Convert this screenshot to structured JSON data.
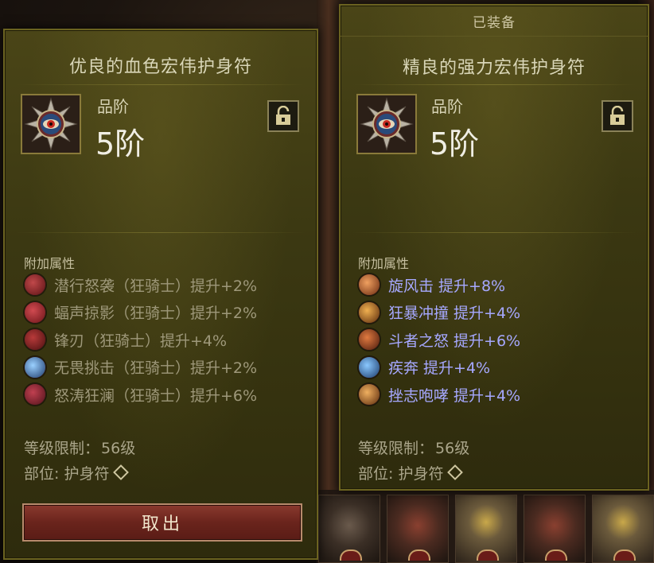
{
  "left_item": {
    "title": "优良的血色宏伟护身符",
    "tier_label": "品阶",
    "tier_value": "5阶",
    "section_label": "附加属性",
    "affixes": [
      {
        "text": "潜行怒袭（狂骑士）提升+2%",
        "icon": "stealth-strike-icon",
        "color": "#7a1e22"
      },
      {
        "text": "蝠声掠影（狂骑士）提升+2%",
        "icon": "bat-shadow-icon",
        "color": "#8a2226"
      },
      {
        "text": "锋刃（狂骑士）提升+4%",
        "icon": "blade-icon",
        "color": "#7a1c1e"
      },
      {
        "text": "无畏挑击（狂骑士）提升+2%",
        "icon": "fearless-strike-icon",
        "color": "#3a6a9a"
      },
      {
        "text": "怒涛狂澜（狂骑士）提升+6%",
        "icon": "rage-wave-icon",
        "color": "#7a1e26"
      }
    ],
    "level_req_label": "等级限制：",
    "level_req_value": "56级",
    "slot_label": "部位:",
    "slot_value": "护身符",
    "button_label": "取出"
  },
  "right_item": {
    "equipped_label": "已装备",
    "title": "精良的强力宏伟护身符",
    "tier_label": "品阶",
    "tier_value": "5阶",
    "section_label": "附加属性",
    "affixes": [
      {
        "text": "旋风击  提升+8%",
        "icon": "whirlwind-icon",
        "color": "#b8562a"
      },
      {
        "text": "狂暴冲撞  提升+4%",
        "icon": "furious-charge-icon",
        "color": "#a8601e"
      },
      {
        "text": "斗者之怒  提升+6%",
        "icon": "wrath-of-berserker-icon",
        "color": "#9a3a22"
      },
      {
        "text": "疾奔  提升+4%",
        "icon": "sprint-icon",
        "color": "#3a78b8"
      },
      {
        "text": "挫志咆哮  提升+4%",
        "icon": "challenging-shout-icon",
        "color": "#a8641e"
      }
    ],
    "level_req_label": "等级限制：",
    "level_req_value": "56级",
    "slot_label": "部位:",
    "slot_value": "护身符"
  }
}
